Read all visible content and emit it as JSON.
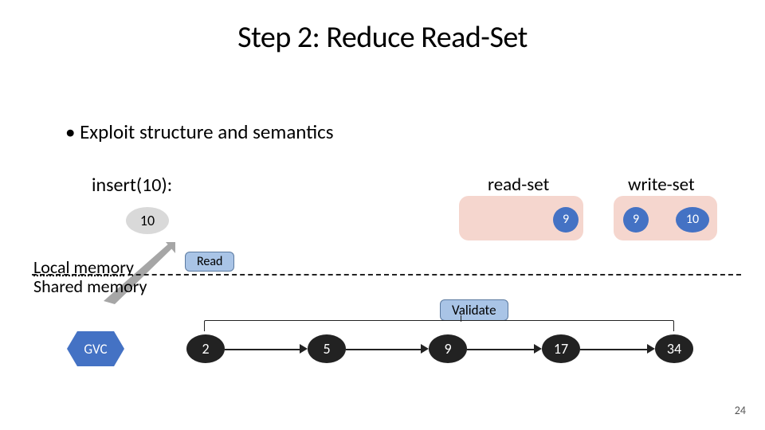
{
  "title": "Step 2: Reduce Read-Set",
  "bullet": "• Exploit structure and semantics",
  "insert_label": "insert(10):",
  "node_pending": "10",
  "readset": {
    "label": "read-set",
    "items": [
      "9"
    ]
  },
  "writeset": {
    "label": "write-set",
    "items": [
      "9",
      "10"
    ]
  },
  "local_mem": "Local memory",
  "shared_mem": "Shared memory",
  "read_label": "Read",
  "validate_label": "Validate",
  "gvc": "GVC",
  "list_nodes": [
    "2",
    "5",
    "9",
    "17",
    "34"
  ],
  "page": "24"
}
